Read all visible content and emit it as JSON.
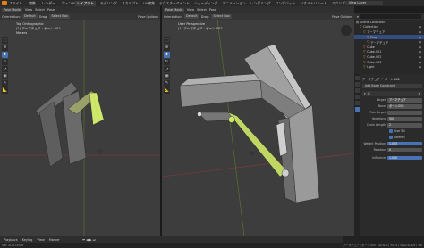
{
  "menu": [
    "ファイル",
    "編集",
    "レンダー",
    "ウィンドウ",
    "ヘルプ"
  ],
  "workspace_tabs": [
    "レイアウト",
    "モデリング",
    "スカルプト",
    "UV編集",
    "テクスチャペイント",
    "シェーディング",
    "アニメーション",
    "レンダリング",
    "コンポジット",
    "ジオメトリノード",
    "スクリプト"
  ],
  "active_workspace": "レイアウト",
  "view_layer": "View Layer",
  "left_viewport": {
    "mode": "Pose Mode",
    "menus": [
      "View",
      "Select",
      "Pose"
    ],
    "orientation_label": "Orientation:",
    "orientation_value": "Default",
    "drag_label": "Drag:",
    "drag_value": "Select Box",
    "pose_options": "Pose Options",
    "overlay_line1": "Top Orthographic",
    "overlay_line2": "(1) アーマチュア : ボーン.002",
    "overlay_line3": "Meters"
  },
  "right_viewport": {
    "mode": "Pose Mode",
    "menus": [
      "View",
      "Select",
      "Pose"
    ],
    "orientation_label": "Orientation:",
    "orientation_value": "Default",
    "drag_label": "Drag:",
    "drag_value": "Select Box",
    "pose_options": "Pose Options",
    "overlay_line1": "User Perspective",
    "overlay_line2": "(1) アーマチュア : ボーン.002"
  },
  "outliner": {
    "title": "Scene Collection",
    "items": [
      {
        "label": "Collection",
        "indent": 1
      },
      {
        "label": "アーマチュア",
        "indent": 2
      },
      {
        "label": "Pose",
        "indent": 3
      },
      {
        "label": "アーマチュア",
        "indent": 3
      },
      {
        "label": "Cube",
        "indent": 2
      },
      {
        "label": "Cube.001",
        "indent": 2
      },
      {
        "label": "Cube.002",
        "indent": 2
      },
      {
        "label": "Cube.003",
        "indent": 2
      },
      {
        "label": "Light",
        "indent": 2
      }
    ]
  },
  "properties": {
    "breadcrumb_armature": "アーマチュア",
    "breadcrumb_bone": "ボーン.002",
    "constraint_button": "Add Bone Constraint",
    "constraint_name": "IK",
    "fields": [
      {
        "label": "Target",
        "value": "アーマチュア"
      },
      {
        "label": "Bone",
        "value": "ボーン.003"
      },
      {
        "label": "Pole Target",
        "value": ""
      },
      {
        "label": "Iterations",
        "value": "500"
      },
      {
        "label": "Chain Length",
        "value": "2"
      }
    ],
    "checks": [
      "Use Tail",
      "Stretch"
    ],
    "weight_label": "Weight Position",
    "weight_value": "1.000",
    "rotation_label": "Rotation",
    "rotation_value": "0",
    "influence_label": "Influence",
    "influence_value": "1.000"
  },
  "timeline": {
    "playback": "Playback",
    "keying": "Keying",
    "view": "View",
    "marker": "Marker"
  },
  "status": {
    "left": "Set 3D Cursor",
    "right": "アーマチュア | ボーン.002 | Verts:0 | Tris:0 | Objects 1/6 | 3.0"
  },
  "colors": {
    "accent": "#4772b3",
    "bone_selected": "#cde86a",
    "ik_line": "#d2c94a",
    "viewport_bg": "#3d3d3d"
  }
}
